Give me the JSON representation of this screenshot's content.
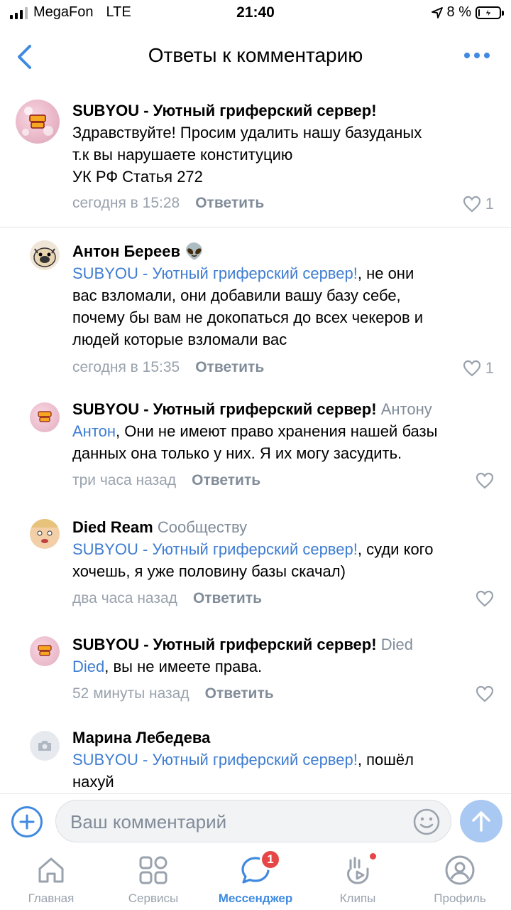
{
  "status_bar": {
    "carrier": "MegaFon",
    "network": "LTE",
    "time": "21:40",
    "battery_percent": "8 %",
    "battery_level": 0.08
  },
  "header": {
    "title": "Ответы к комментарию",
    "back_icon": "chevron-left-icon",
    "more_icon": "more-dots-icon"
  },
  "comments": [
    {
      "author": "SUBYOU - Уютный гриферский сервер!",
      "reply_to": "",
      "mention": "",
      "text_lines": [
        "Здравствуйте! Просим удалить нашу базуданых",
        "т.к вы нарушаете конституцию",
        "УК РФ Статья 272"
      ],
      "time": "сегодня в 15:28",
      "reply_label": "Ответить",
      "likes": "1"
    },
    {
      "author": "Антон Береев",
      "author_emoji": "👽",
      "mention": "SUBYOU - Уютный гриферский сервер!",
      "text_after_mention": ", не они",
      "text_lines": [
        "вас взломали, они добавили вашу базу себе,",
        "почему бы вам не докопаться до всех чекеров и",
        "людей которые взломали вас"
      ],
      "time": "сегодня в 15:35",
      "reply_label": "Ответить",
      "likes": "1"
    },
    {
      "author": "SUBYOU - Уютный гриферский сервер!",
      "reply_to": "Антону",
      "mention": "Антон",
      "text_after_mention": ", Они не имеют право хранения нашей базы",
      "text_lines": [
        "данных она только у них. Я их могу засудить."
      ],
      "time": "три часа назад",
      "reply_label": "Ответить",
      "likes": ""
    },
    {
      "author": "Died Ream",
      "reply_to": "Сообществу",
      "mention": "SUBYOU - Уютный гриферский сервер!",
      "text_after_mention": ", суди кого",
      "text_lines": [
        "хочешь, я уже половину базы скачал)"
      ],
      "time": "два часа назад",
      "reply_label": "Ответить",
      "likes": ""
    },
    {
      "author": "SUBYOU - Уютный гриферский сервер!",
      "reply_to": "Died",
      "mention": "Died",
      "text_after_mention": ", вы не имеете права.",
      "text_lines": [],
      "time": "52 минуты назад",
      "reply_label": "Ответить",
      "likes": ""
    },
    {
      "author": "Марина Лебедева",
      "reply_to": "",
      "mention": "SUBYOU - Уютный гриферский сервер!",
      "text_after_mention": ", пошёл",
      "text_lines": [
        "нахуй"
      ]
    }
  ],
  "composer": {
    "placeholder": "Ваш комментарий"
  },
  "tabbar": {
    "tabs": [
      {
        "label": "Главная",
        "icon": "home-icon"
      },
      {
        "label": "Сервисы",
        "icon": "services-grid-icon"
      },
      {
        "label": "Мессенджер",
        "icon": "messenger-icon",
        "badge": "1"
      },
      {
        "label": "Клипы",
        "icon": "clips-icon"
      },
      {
        "label": "Профиль",
        "icon": "profile-icon"
      }
    ]
  },
  "colors": {
    "accent": "#3f8ae0",
    "badge": "#e64646",
    "secondary_text": "#99a2ad"
  }
}
